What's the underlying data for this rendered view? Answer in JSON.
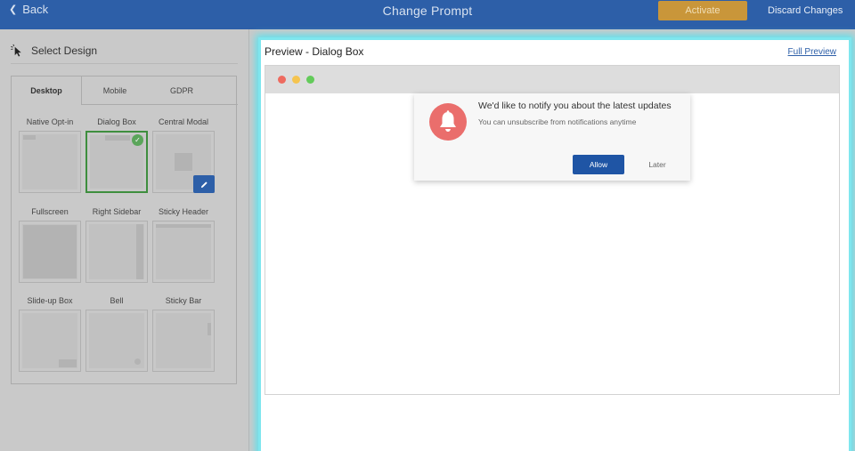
{
  "topbar": {
    "back_label": "Back",
    "title": "Change Prompt",
    "activate_label": "Activate",
    "discard_label": "Discard Changes",
    "bg_color": "#2d5fa8",
    "activate_color": "#c9963a"
  },
  "sidebar": {
    "header": "Select Design",
    "tabs": [
      {
        "label": "Desktop",
        "active": true
      },
      {
        "label": "Mobile",
        "active": false
      },
      {
        "label": "GDPR",
        "active": false
      }
    ],
    "designs": [
      {
        "label": "Native Opt-in",
        "selected": false
      },
      {
        "label": "Dialog Box",
        "selected": true
      },
      {
        "label": "Central Modal",
        "selected": false
      },
      {
        "label": "Fullscreen",
        "selected": false
      },
      {
        "label": "Right Sidebar",
        "selected": false
      },
      {
        "label": "Sticky Header",
        "selected": false
      },
      {
        "label": "Slide-up Box",
        "selected": false
      },
      {
        "label": "Bell",
        "selected": false
      },
      {
        "label": "Sticky Bar",
        "selected": false
      }
    ],
    "check_glyph": "✓"
  },
  "preview": {
    "title": "Preview - Dialog Box",
    "full_preview_label": "Full Preview",
    "dialog": {
      "title": "We'd like to notify you about the latest updates",
      "subtitle": "You can unsubscribe from notifications anytime",
      "allow_label": "Allow",
      "later_label": "Later",
      "icon": "bell-icon",
      "icon_color": "#ea6e6c",
      "allow_color": "#1f55a5"
    }
  }
}
